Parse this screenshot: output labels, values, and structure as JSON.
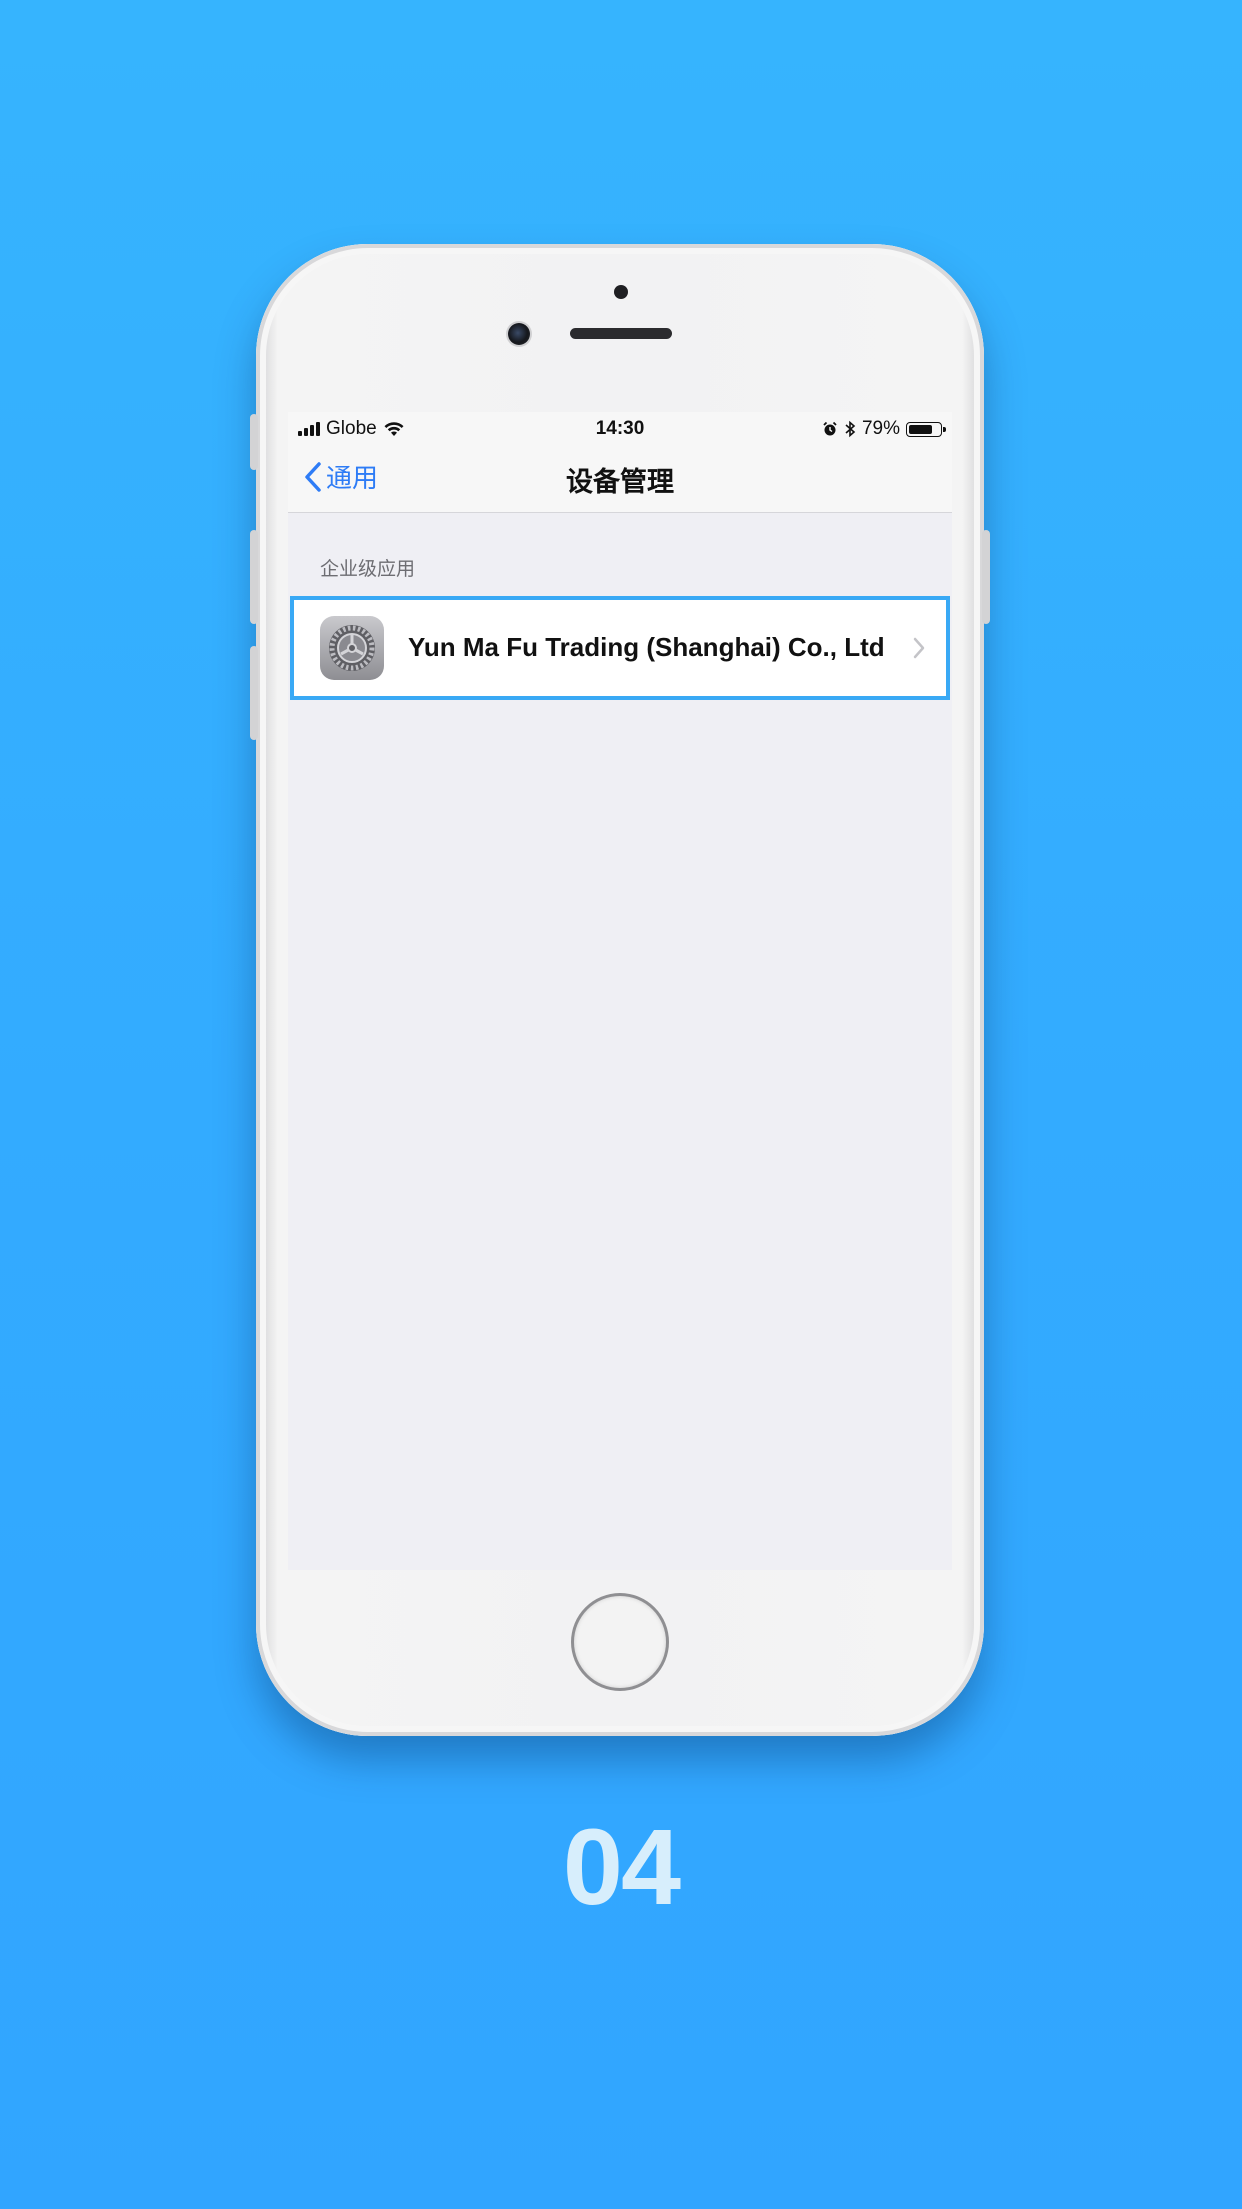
{
  "status_bar": {
    "carrier": "Globe",
    "time": "14:30",
    "battery_percent": "79%",
    "battery_level": 0.79,
    "icons": [
      "signal-icon",
      "wifi-icon",
      "alarm-icon",
      "bluetooth-icon",
      "battery-icon"
    ]
  },
  "nav": {
    "back_label": "通用",
    "title": "设备管理"
  },
  "section": {
    "header": "企业级应用",
    "items": [
      {
        "label": "Yun Ma Fu Trading (Shanghai) Co., Ltd",
        "icon": "settings-gear-icon"
      }
    ]
  },
  "page_number": "04",
  "colors": {
    "background": "#33abff",
    "accent": "#2e7cf6",
    "highlight_border": "#39a9f5",
    "page_number": "#d7eefc"
  }
}
